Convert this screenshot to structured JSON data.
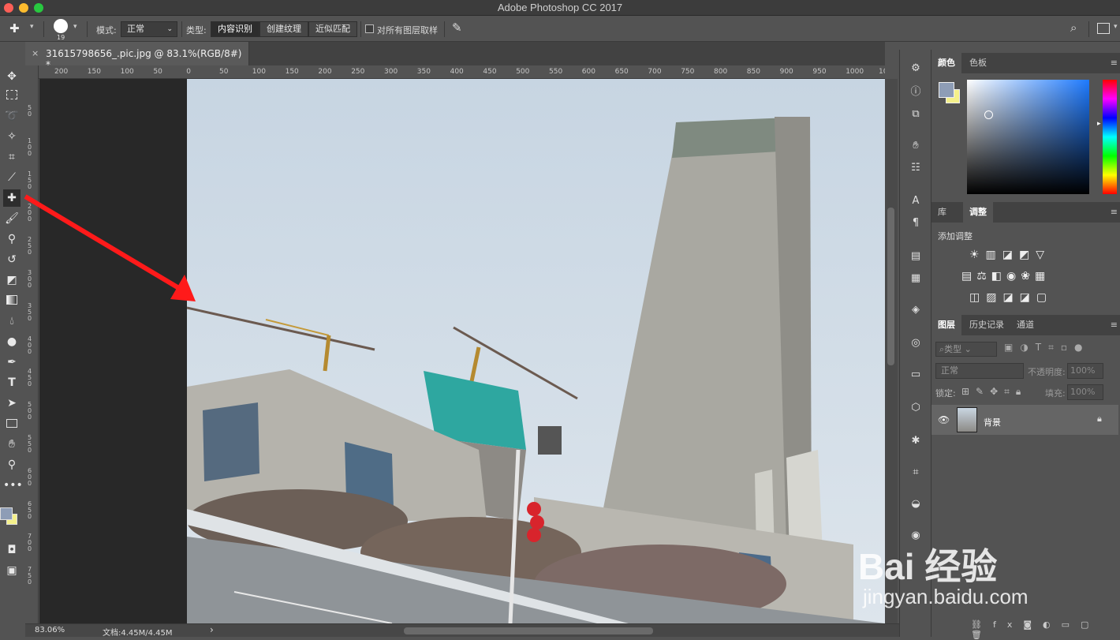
{
  "app_title": "Adobe Photoshop CC 2017",
  "options_bar": {
    "brush_size": "19",
    "mode_label": "模式:",
    "mode_value": "正常",
    "type_label": "类型:",
    "type_buttons": [
      "内容识别",
      "创建纹理",
      "近似匹配"
    ],
    "sample_all_label": "对所有图层取样"
  },
  "document_tab": {
    "title": "31615798656_.pic.jpg @ 83.1%(RGB/8#) *",
    "close": "×"
  },
  "ruler": {
    "h_ticks": [
      "200",
      "150",
      "100",
      "50",
      "0",
      "50",
      "100",
      "150",
      "200",
      "250",
      "300",
      "350",
      "400",
      "450",
      "500",
      "550",
      "600",
      "650",
      "700",
      "750",
      "800",
      "850",
      "900",
      "950",
      "1000",
      "10"
    ],
    "v_ticks": [
      "5 0",
      "1 0 0",
      "1 5 0",
      "2 0 0",
      "2 5 0",
      "3 0 0",
      "3 5 0",
      "4 0 0",
      "4 5 0",
      "5 0 0",
      "5 5 0",
      "6 0 0",
      "6 5 0",
      "7 0 0",
      "7 5 0"
    ]
  },
  "status": {
    "zoom": "83.06%",
    "doc": "文档:4.45M/4.45M",
    "arrow": "›"
  },
  "panels": {
    "color_tabs": [
      "颜色",
      "色板"
    ],
    "adjust_tabs": [
      "库",
      "调整"
    ],
    "adjust_title": "添加调整",
    "layer_tabs": [
      "图层",
      "历史记录",
      "通道"
    ],
    "layer_filter": "类型",
    "blend_mode": "正常",
    "opacity_label": "不透明度:",
    "opacity_value": "100%",
    "lock_label": "锁定:",
    "fill_label": "填充:",
    "fill_value": "100%",
    "layer_name": "背景"
  },
  "watermark": {
    "brand": "Bai 经验",
    "url": "jingyan.baidu.com"
  },
  "colors": {
    "foreground": "#8e9db6",
    "background": "#f4f08a",
    "arrow": "#ff1a1a"
  }
}
